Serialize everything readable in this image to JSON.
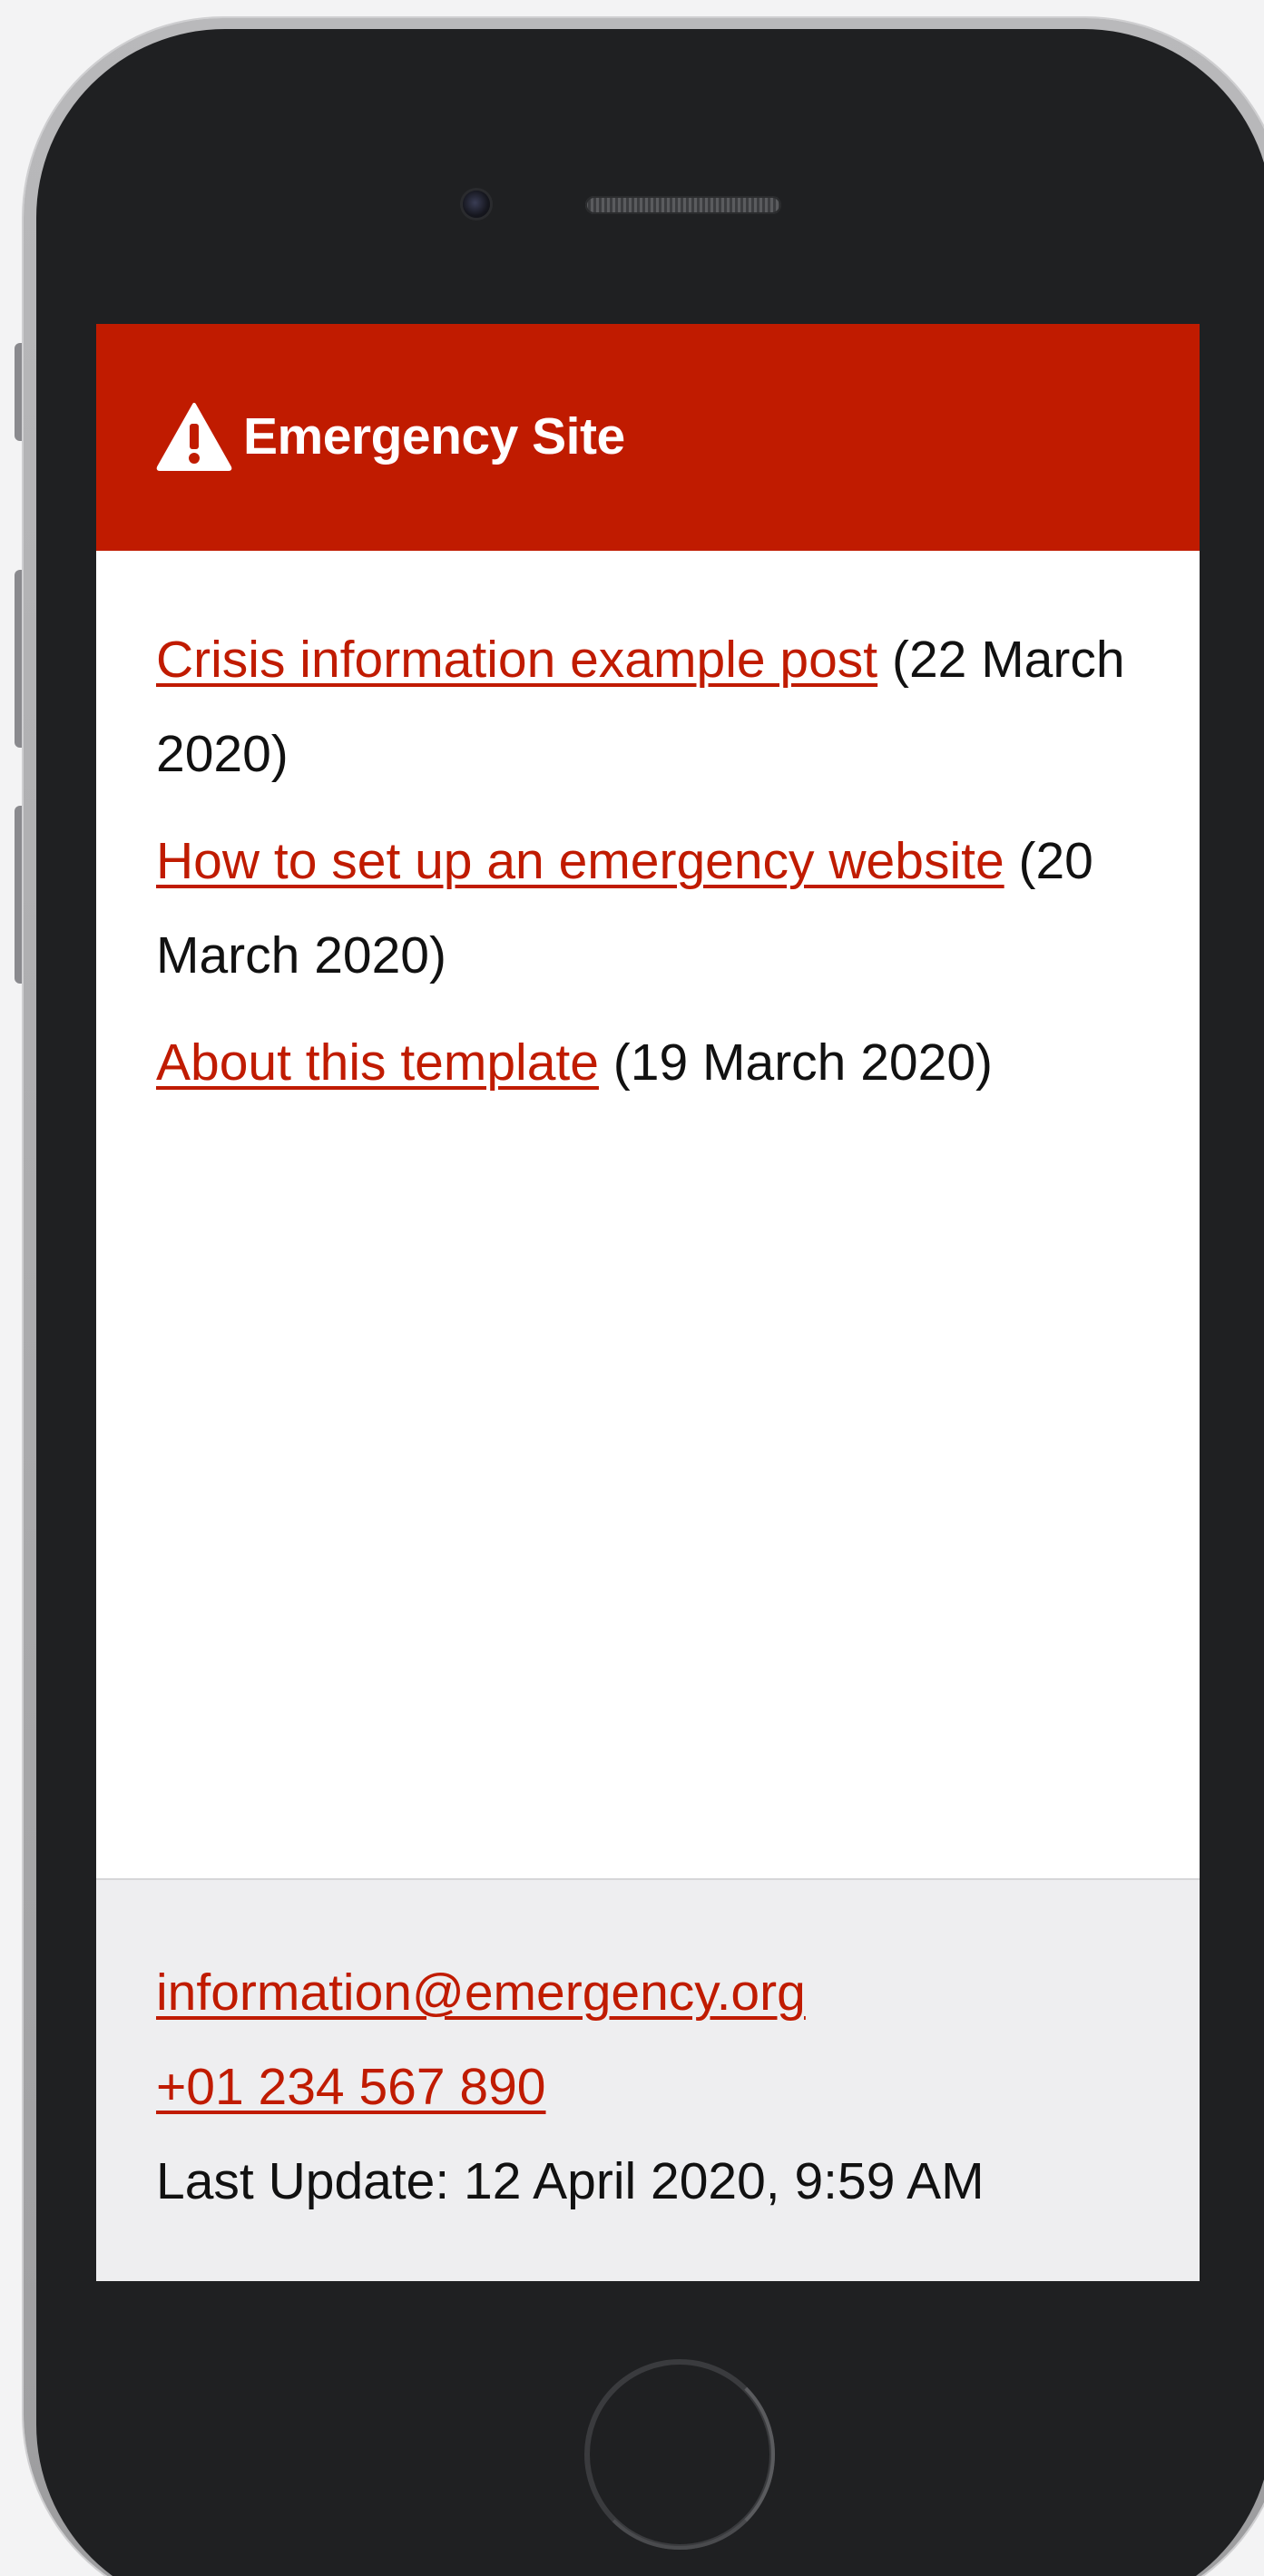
{
  "header": {
    "icon": "warning-triangle-icon",
    "title": "Emergency Site",
    "background_color": "#c01b00"
  },
  "posts": [
    {
      "title": "Crisis information example post",
      "date": "(22 March 2020)"
    },
    {
      "title": "How to set up an emergency website",
      "date": "(20 March 2020)"
    },
    {
      "title": "About this template",
      "date": "(19 March 2020)"
    }
  ],
  "footer": {
    "email": "information@emergency.org",
    "phone": "+01 234 567 890",
    "last_update": "Last Update: 12 April 2020, 9:59 AM"
  },
  "colors": {
    "accent": "#c01b00",
    "footer_bg": "#eeeef0",
    "device_body": "#1f2022"
  }
}
